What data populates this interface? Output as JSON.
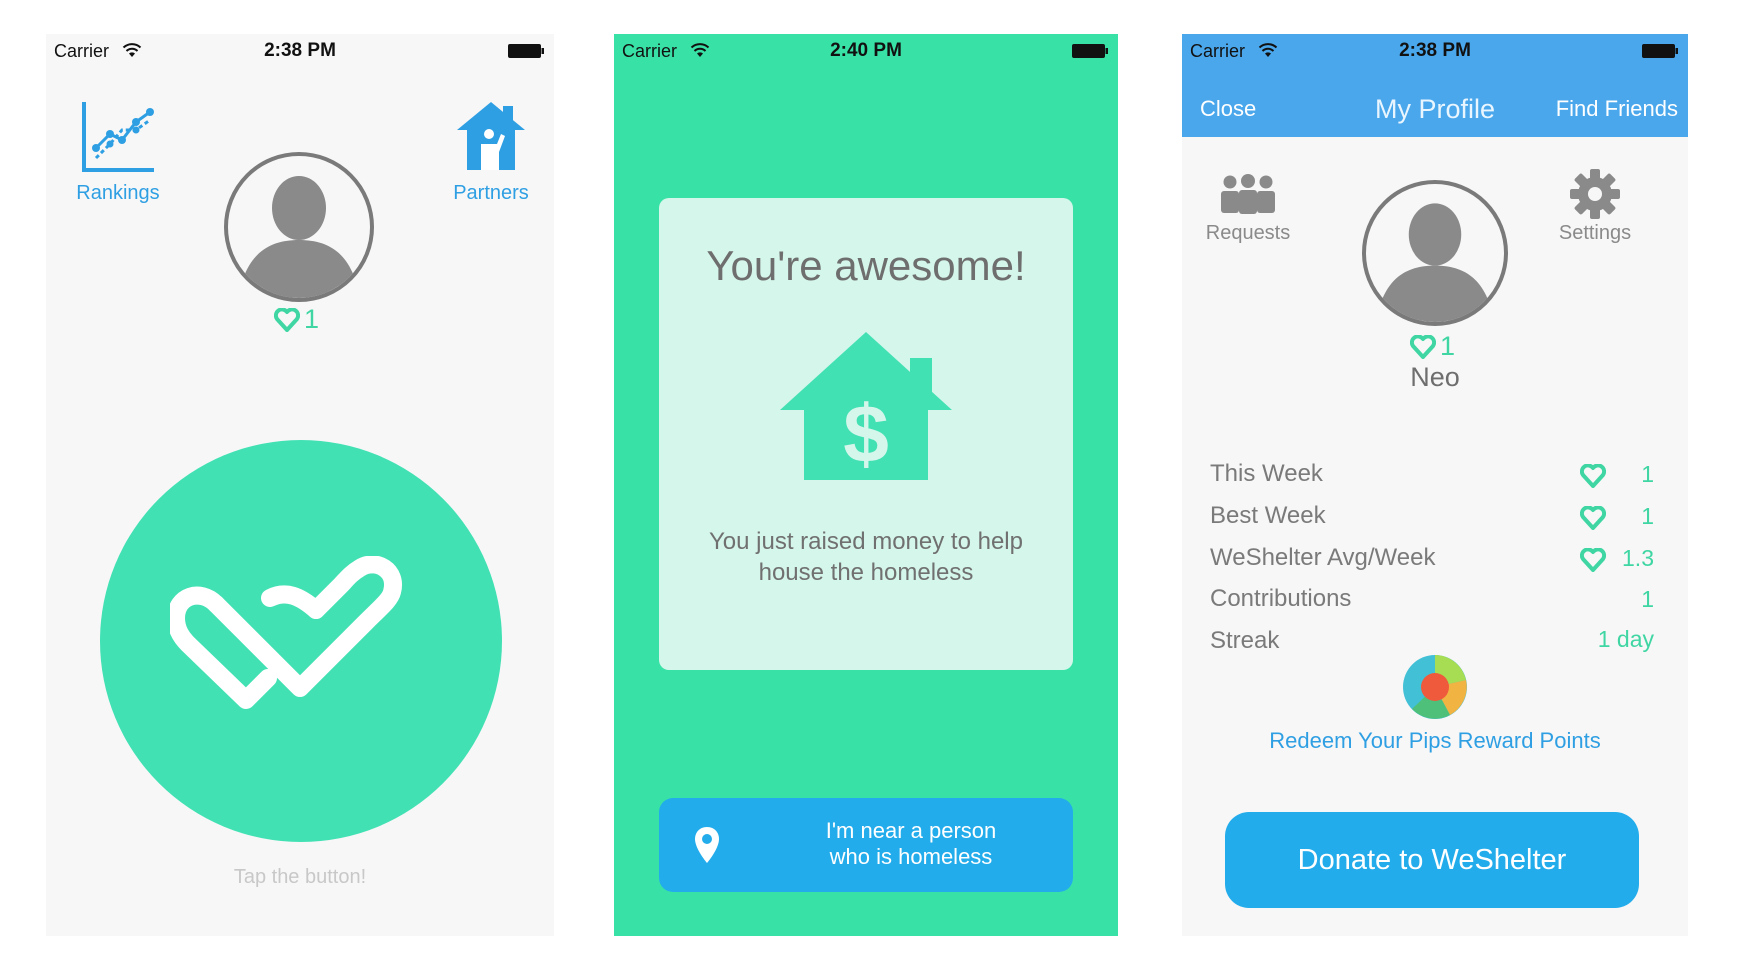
{
  "status_bars": [
    {
      "carrier": "Carrier",
      "time": "2:38 PM"
    },
    {
      "carrier": "Carrier",
      "time": "2:40 PM"
    },
    {
      "carrier": "Carrier",
      "time": "2:38 PM"
    }
  ],
  "screen1": {
    "rankings_label": "Rankings",
    "partners_label": "Partners",
    "heart_count": "1",
    "tap_hint": "Tap the button!"
  },
  "screen2": {
    "card_title": "You're awesome!",
    "card_message_line1": "You just raised money to help",
    "card_message_line2": "house the homeless",
    "near_button_line1": "I'm near a person",
    "near_button_line2": "who is homeless"
  },
  "screen3": {
    "nav_close": "Close",
    "nav_title": "My Profile",
    "nav_find_friends": "Find Friends",
    "requests_label": "Requests",
    "settings_label": "Settings",
    "heart_count": "1",
    "username": "Neo",
    "stats": [
      {
        "label": "This Week",
        "value": "1",
        "heart": true
      },
      {
        "label": "Best Week",
        "value": "1",
        "heart": true
      },
      {
        "label": "WeShelter Avg/Week",
        "value": "1.3",
        "heart": true
      },
      {
        "label": "Contributions",
        "value": "1",
        "heart": false
      },
      {
        "label": "Streak",
        "value": "1 day",
        "heart": false
      }
    ],
    "redeem_link": "Redeem Your Pips Reward Points",
    "donate_button": "Donate to WeShelter"
  },
  "colors": {
    "mint": "#42e1b4",
    "green_bg": "#38e2a6",
    "blue": "#23aceb",
    "nav_blue": "#4aa7ec",
    "link_blue": "#2f9fe3"
  },
  "icons": [
    "wifi-icon",
    "battery-icon",
    "rankings-chart-icon",
    "partners-house-icon",
    "avatar-person-icon",
    "heart-icon",
    "weshelter-logo-icon",
    "house-dollar-icon",
    "location-pin-icon",
    "requests-group-icon",
    "settings-gear-icon",
    "pips-logo-icon"
  ]
}
